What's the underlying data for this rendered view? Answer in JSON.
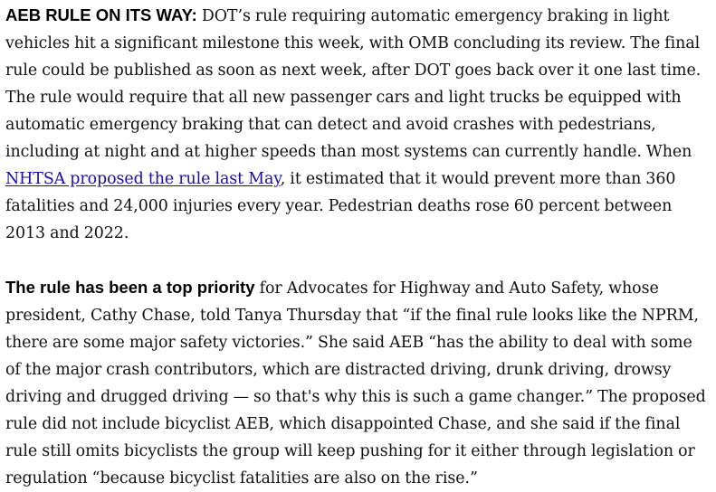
{
  "article": {
    "paragraphs": [
      {
        "lead": "AEB RULE ON ITS WAY:",
        "text_before_link": " DOT’s rule requiring automatic emergency braking in light vehicles hit a significant milestone this week, with OMB concluding its review. The final rule could be published as soon as next week, after DOT goes back over it one last time. The rule would require that all new passenger cars and light trucks be equipped with automatic emergency braking that can detect and avoid crashes with pedestrians, including at night and at higher speeds than most systems can currently handle. When ",
        "link_text": "NHTSA proposed the rule last May",
        "text_after_link": ", it estimated that it would prevent more than 360 fatalities and 24,000 injuries every year. Pedestrian deaths rose 60 percent between 2013 and 2022."
      },
      {
        "lead": "The rule has been a top priority",
        "text": " for Advocates for Highway and Auto Safety, whose president, Cathy Chase, told Tanya Thursday that “if the final rule looks like the NPRM, there are some major safety victories.” She said AEB “has the ability to deal with some of the major crash contributors, which are distracted driving, drunk driving, drowsy driving and drugged driving — so that's why this is such a game changer.” The proposed rule did not include bicyclist AEB, which disappointed Chase, and she said if the final rule still omits bicyclists the group will keep pushing for it either through legislation or regulation “because bicyclist fatalities are also on the rise.”"
      }
    ],
    "colors": {
      "text": "#111111",
      "link": "#1a0dab",
      "background": "#ffffff"
    }
  }
}
